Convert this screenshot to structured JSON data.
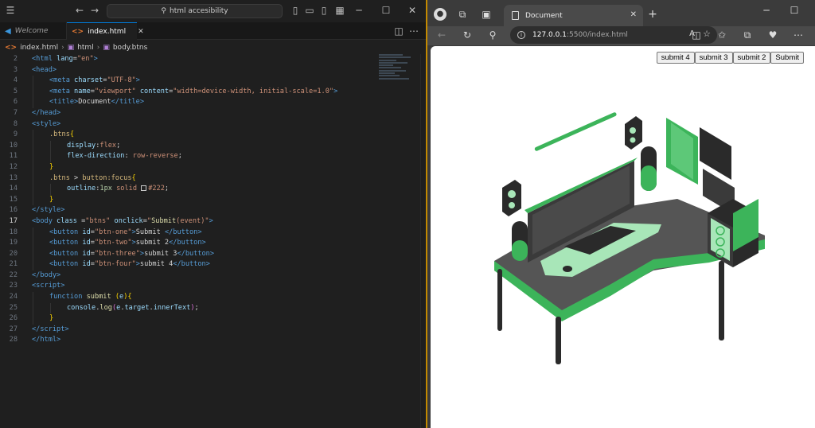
{
  "vscode": {
    "search_text": "html accesibility",
    "tabs": [
      {
        "label": "Welcome"
      },
      {
        "label": "index.html"
      }
    ],
    "breadcrumb": [
      "index.html",
      "html",
      "body.btns"
    ],
    "current_line": 17
  },
  "browser": {
    "tab_title": "Document",
    "url_host": "127.0.0.1",
    "url_path": ":5500/index.html",
    "buttons": [
      {
        "label": "submit 4"
      },
      {
        "label": "submit 3"
      },
      {
        "label": "submit 2"
      },
      {
        "label": "Submit"
      }
    ]
  },
  "colors": {
    "accent_green": "#3cb45a",
    "window_border": "#c48a00"
  }
}
